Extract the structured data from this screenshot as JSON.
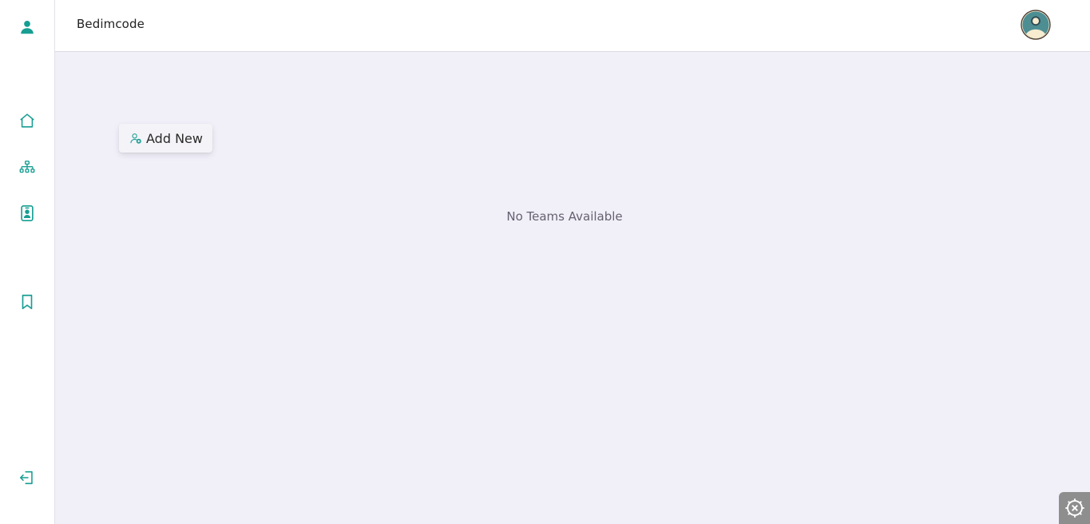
{
  "sidebar": {
    "items": [
      {
        "icon": "user-icon",
        "label": "Profile"
      },
      {
        "icon": "home-icon",
        "label": "Home"
      },
      {
        "icon": "sitemap-icon",
        "label": "Teams"
      },
      {
        "icon": "id-badge-icon",
        "label": "Contacts"
      },
      {
        "icon": "bookmark-icon",
        "label": "Bookmarks"
      },
      {
        "icon": "logout-icon",
        "label": "Logout"
      }
    ]
  },
  "header": {
    "brand": "Bedimcode",
    "avatar_icon": "user-avatar-icon"
  },
  "main": {
    "add_button_label": "Add New",
    "add_button_icon": "user-add-icon",
    "empty_message": "No Teams Available"
  },
  "settings_icon": "gear-icon",
  "colors": {
    "accent": "#179e93",
    "background": "#f1eff8",
    "avatar_bg": "#4d8e93",
    "avatar_skin": "#f7ecd0"
  }
}
